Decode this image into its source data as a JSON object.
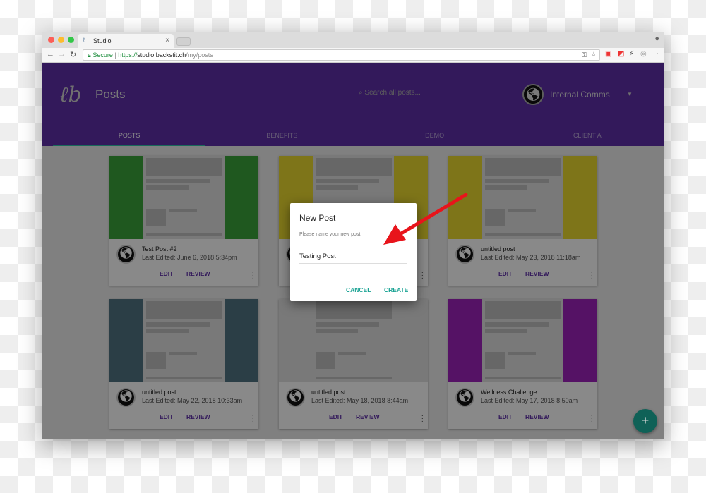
{
  "browser": {
    "tab_title": "Studio",
    "url_secure": "Secure",
    "url_scheme": "https://",
    "url_host": "studio.backstit.ch",
    "url_path": "/my/posts"
  },
  "header": {
    "title": "Posts",
    "search_placeholder": "Search all posts...",
    "account": "Internal Comms"
  },
  "tabs": [
    "POSTS",
    "BENEFITS",
    "DEMO",
    "CLIENT A"
  ],
  "posts": [
    {
      "name": "Test Post #2",
      "date": "Last Edited: June 6, 2018 5:34pm",
      "color": "#3aa13a"
    },
    {
      "name": "",
      "date": "",
      "color": "#e6d62e"
    },
    {
      "name": "untitled post",
      "date": "Last Edited: May 23, 2018 11:18am",
      "color": "#e6d62e"
    },
    {
      "name": "untitled post",
      "date": "Last Edited: May 22, 2018 10:33am",
      "color": "#4f7280"
    },
    {
      "name": "untitled post",
      "date": "Last Edited: May 18, 2018 8:44am",
      "color": "#dddddd"
    },
    {
      "name": "Wellness Challenge",
      "date": "Last Edited: May 17, 2018 8:50am",
      "color": "#9b22b8"
    }
  ],
  "card_actions": {
    "edit": "EDIT",
    "review": "REVIEW"
  },
  "dialog": {
    "title": "New Post",
    "hint": "Please name your new post",
    "value": "Testing Post",
    "cancel": "CANCEL",
    "create": "CREATE"
  },
  "fab": "+",
  "colors": {
    "header": "#5d2fa6",
    "accent": "#1aa394",
    "arrow": "#e8141b"
  }
}
